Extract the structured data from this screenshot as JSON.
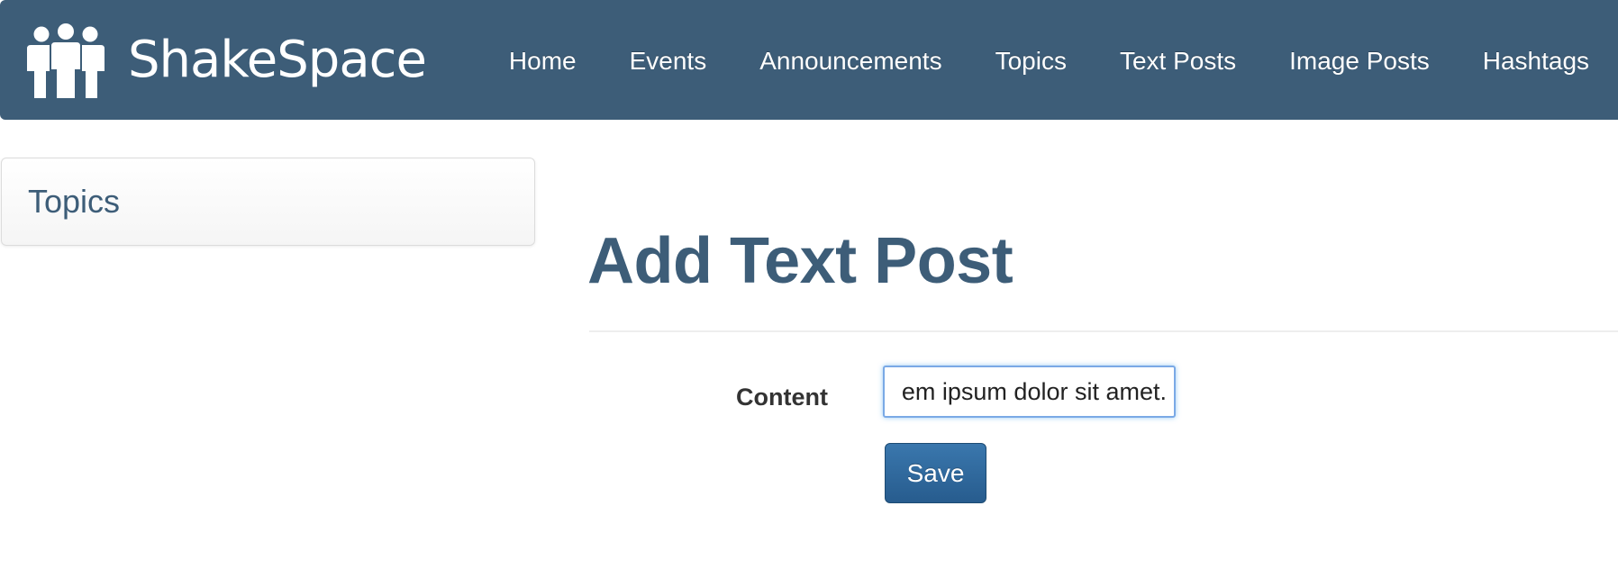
{
  "brand": {
    "name": "ShakeSpace",
    "icon": "people-group-icon"
  },
  "nav": {
    "items": [
      {
        "label": "Home"
      },
      {
        "label": "Events"
      },
      {
        "label": "Announcements"
      },
      {
        "label": "Topics"
      },
      {
        "label": "Text Posts"
      },
      {
        "label": "Image Posts"
      },
      {
        "label": "Hashtags"
      }
    ]
  },
  "sidebar": {
    "title": "Topics"
  },
  "main": {
    "title": "Add Text Post",
    "form": {
      "content_label": "Content",
      "content_value": "em ipsum dolor sit amet.",
      "save_label": "Save"
    }
  },
  "colors": {
    "navbar": "#3d5d78",
    "accent_text": "#3d5d78",
    "primary_button": "#2f6a9e"
  }
}
